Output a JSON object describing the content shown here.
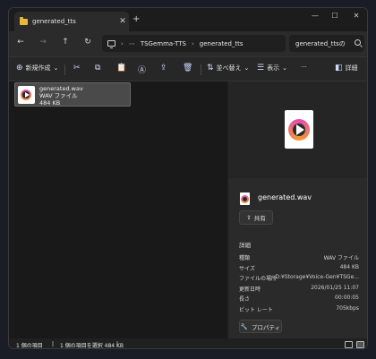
{
  "tab": {
    "title": "generated_tts",
    "close": "✕",
    "new": "+"
  },
  "window_controls": {
    "minimize": "—",
    "maximize": "☐",
    "close": "✕"
  },
  "nav": {
    "back": "←",
    "forward": "→",
    "up": "↑",
    "refresh": "↻",
    "more": "⋯"
  },
  "address": {
    "crumbs": [
      "TSGemma-TTS",
      "generated_tts"
    ],
    "separator": "›"
  },
  "search": {
    "value": "generated_ttsの"
  },
  "command_bar": {
    "new": "新規作成",
    "new_chevron": "⌄",
    "sort": "並べ替え",
    "view": "表示",
    "more": "···",
    "details": "詳細",
    "icons": {
      "cut": "✂",
      "copy": "⧉",
      "paste": "📋",
      "rename": "Ⓐ",
      "share": "⇪",
      "delete": "🗑",
      "sort": "⇅",
      "view": "☰",
      "details": "◧",
      "new": "⊕"
    }
  },
  "file": {
    "name": "generated.wav",
    "type": "WAV ファイル",
    "size": "484 KB"
  },
  "details": {
    "title": "generated.wav",
    "share": "共有",
    "share_icon": "⇪",
    "section": "詳細",
    "rows": [
      {
        "key": "種類",
        "value": "WAV ファイル"
      },
      {
        "key": "サイズ",
        "value": "484 KB"
      },
      {
        "key": "ファイルの場所",
        "value": "D:¥Storage¥Voice-Gen¥TSGe..."
      },
      {
        "key": "更新日時",
        "value": "2026/01/25 11:07"
      },
      {
        "key": "長さ",
        "value": "00:00:05"
      },
      {
        "key": "ビット レート",
        "value": "705kbps"
      }
    ],
    "properties": "プロパティ",
    "properties_icon": "🔧"
  },
  "status": {
    "count": "1 個の項目",
    "selection": "1 個の項目を選択  484 KB",
    "sep": "|"
  },
  "colors": {
    "folder": "#e8b93a",
    "accent": "#cfd8ff",
    "background": "#202020"
  }
}
